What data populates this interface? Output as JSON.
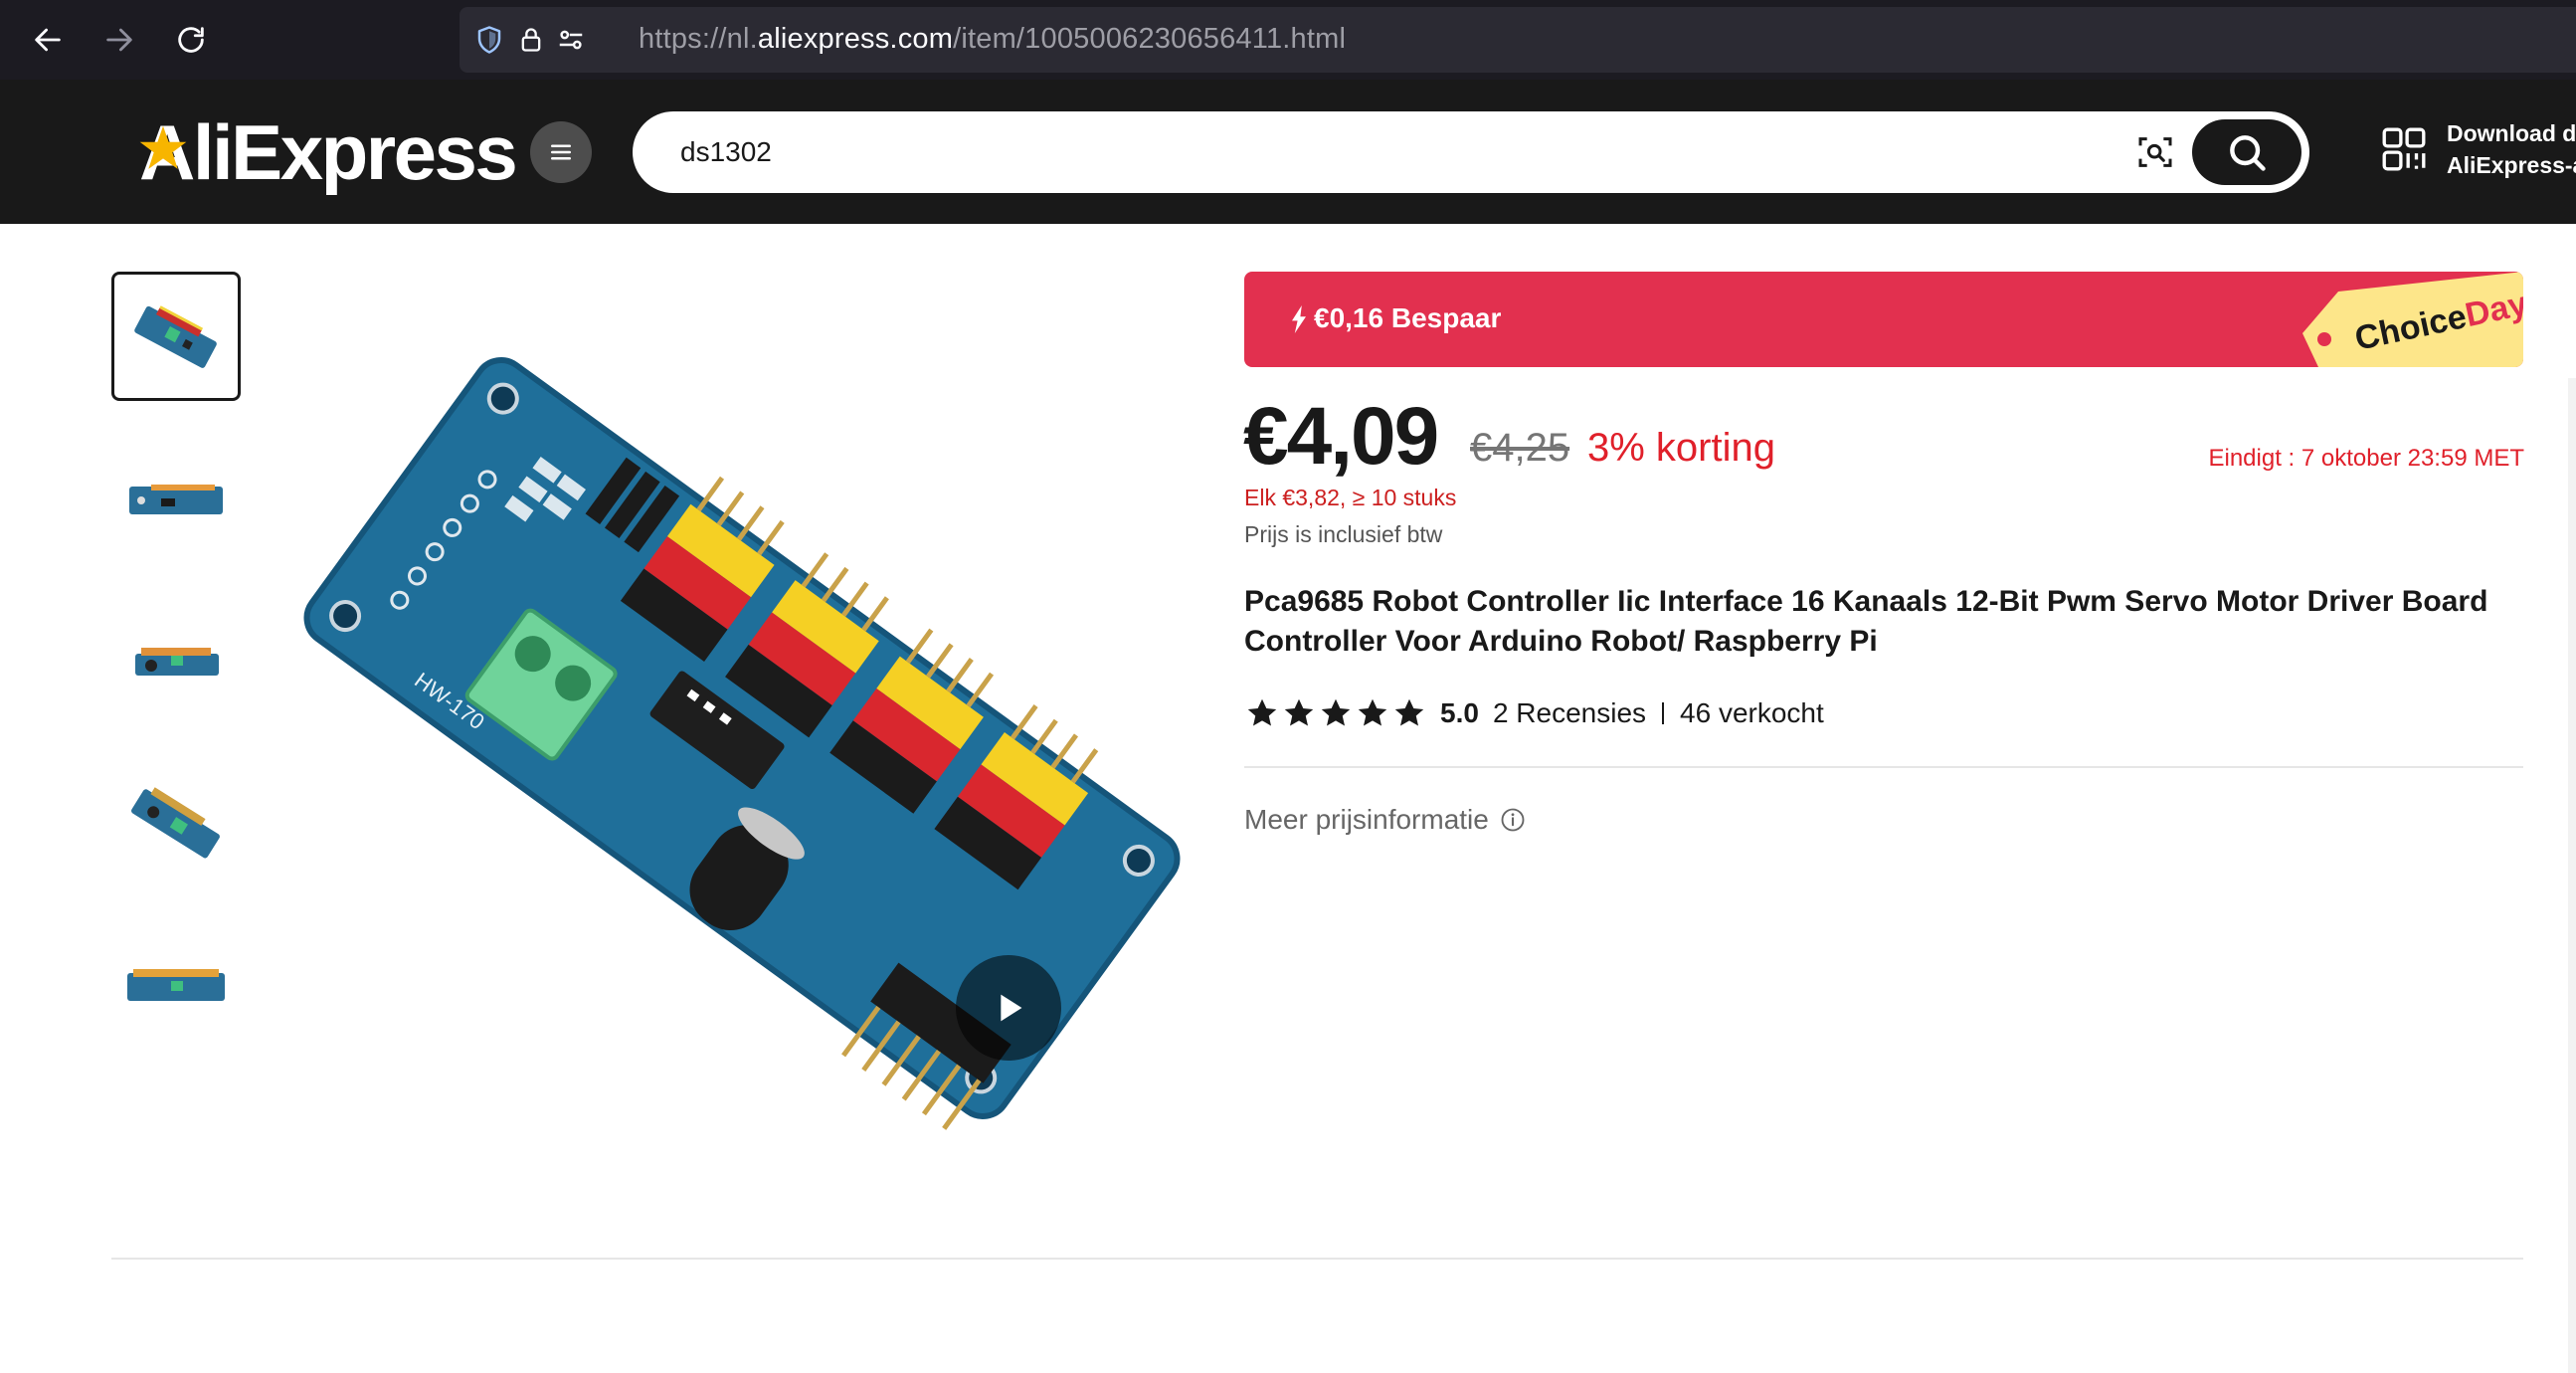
{
  "browser": {
    "url_prefix": "https://nl.",
    "url_domain": "aliexpress.com",
    "url_path": "/item/1005006230656411.html"
  },
  "header": {
    "logo_text": "AliExpress",
    "search_value": "ds1302",
    "download_line1": "Download d",
    "download_line2": "AliExpress-a"
  },
  "promo": {
    "text": "€0,16 Bespaar",
    "tag_choice": "Choice",
    "tag_day": "Day"
  },
  "pricing": {
    "price": "€4,09",
    "old_price": "€4,25",
    "discount": "3% korting",
    "ends": "Eindigt :  7 oktober 23:59 MET",
    "bulk": "Elk €3,82, ≥ 10 stuks",
    "vat": "Prijs is inclusief btw"
  },
  "product": {
    "title": "Pca9685 Robot Controller Iic Interface 16 Kanaals 12-Bit Pwm Servo Motor Driver Board Controller Voor Arduino Robot/ Raspberry Pi",
    "rating": "5.0",
    "rating_value": 5,
    "reviews": "2 Recensies",
    "sold": "46 verkocht",
    "more_price_info": "Meer prijsinformatie",
    "board_label": "HW-170"
  },
  "colors": {
    "promo_red": "#e2304f",
    "discount_red": "#e0202a",
    "header_bg": "#191919",
    "choice_yellow": "#fde68a",
    "pcb_blue": "#1f6f9a"
  },
  "icons": [
    "back-icon",
    "forward-icon",
    "reload-icon",
    "shield-icon",
    "lock-icon",
    "permissions-icon",
    "menu-icon",
    "camera-search-icon",
    "search-icon",
    "qr-code-icon",
    "bolt-icon",
    "play-icon",
    "star-icon",
    "info-icon"
  ]
}
